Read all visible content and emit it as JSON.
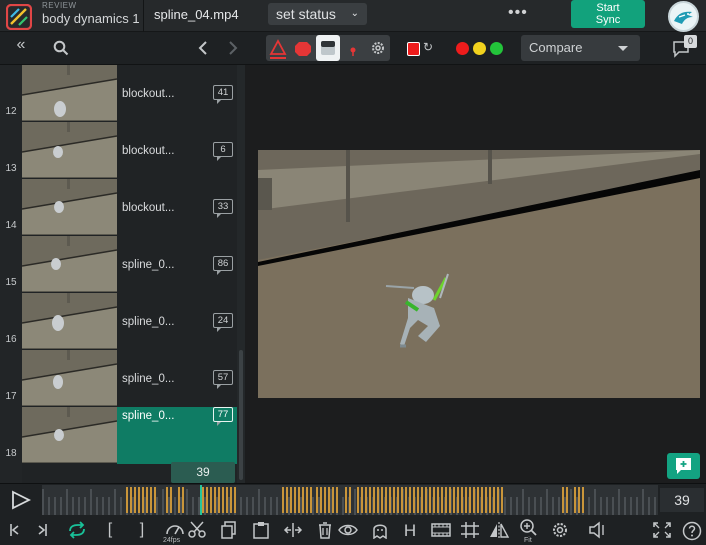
{
  "header": {
    "review_label": "REVIEW",
    "project_name": "body dynamics 1",
    "file_name": "spline_04.mp4",
    "status_label": "set status",
    "more": "•••",
    "sync_line1": "Start",
    "sync_line2": "Sync"
  },
  "toolbar": {
    "compare_label": "Compare",
    "comments_count": "0",
    "annotation_colors": [
      "#ee1c1c",
      "#f2d21e",
      "#23c43a"
    ],
    "active_color": "#ee1c1c"
  },
  "playlist": {
    "items": [
      {
        "num": "12",
        "name": "blockout...",
        "comments": "41"
      },
      {
        "num": "13",
        "name": "blockout...",
        "comments": "6"
      },
      {
        "num": "14",
        "name": "blockout...",
        "comments": "33"
      },
      {
        "num": "15",
        "name": "spline_0...",
        "comments": "86"
      },
      {
        "num": "16",
        "name": "spline_0...",
        "comments": "24"
      },
      {
        "num": "17",
        "name": "spline_0...",
        "comments": "57"
      },
      {
        "num": "18",
        "name": "spline_0...",
        "comments": "77"
      }
    ],
    "current_frame": "39"
  },
  "timeline": {
    "current_frame": "39",
    "fps_label": "24fps",
    "fit_label": "Fit"
  },
  "colors": {
    "accent": "#13a382",
    "marker": "#c9953a",
    "active_row": "#0f7c64"
  }
}
